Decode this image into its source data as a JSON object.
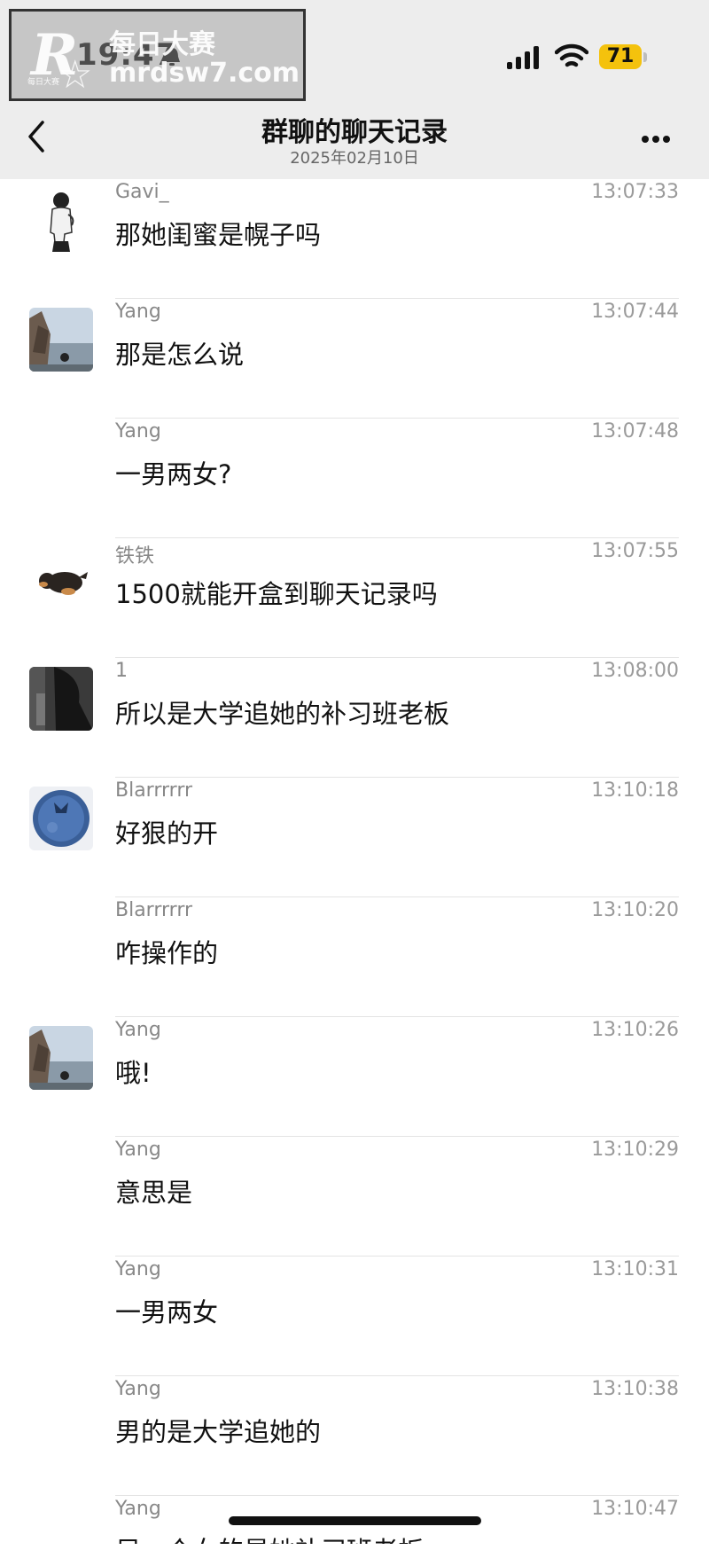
{
  "status_bar": {
    "time": "19:47",
    "battery": "71"
  },
  "watermark": {
    "logo": "R",
    "cn": "每日大赛",
    "url": "mrdsw7.com",
    "small": "每日大赛"
  },
  "nav": {
    "title": "群聊的聊天记录",
    "date": "2025年02月10日"
  },
  "messages": [
    {
      "sender": "Gavi_",
      "time": "13:07:33",
      "text": "那她闺蜜是幌子吗",
      "avatar": "person-bw"
    },
    {
      "sender": "Yang",
      "time": "13:07:44",
      "text": "那是怎么说",
      "avatar": "seaside"
    },
    {
      "sender": "Yang",
      "time": "13:07:48",
      "text": "一男两女?",
      "avatar": ""
    },
    {
      "sender": "铁铁",
      "time": "13:07:55",
      "text": "1500就能开盒到聊天记录吗",
      "avatar": "dog"
    },
    {
      "sender": "1",
      "time": "13:08:00",
      "text": "所以是大学追她的补习班老板",
      "avatar": "dark-photo"
    },
    {
      "sender": "Blarrrrrr",
      "time": "13:10:18",
      "text": "好狠的开",
      "avatar": "blueberry"
    },
    {
      "sender": "Blarrrrrr",
      "time": "13:10:20",
      "text": "咋操作的",
      "avatar": ""
    },
    {
      "sender": "Yang",
      "time": "13:10:26",
      "text": "哦!",
      "avatar": "seaside"
    },
    {
      "sender": "Yang",
      "time": "13:10:29",
      "text": "意思是",
      "avatar": ""
    },
    {
      "sender": "Yang",
      "time": "13:10:31",
      "text": "一男两女",
      "avatar": ""
    },
    {
      "sender": "Yang",
      "time": "13:10:38",
      "text": "男的是大学追她的",
      "avatar": ""
    },
    {
      "sender": "Yang",
      "time": "13:10:47",
      "text": "另一个女的是她补习班老板",
      "avatar": ""
    }
  ]
}
